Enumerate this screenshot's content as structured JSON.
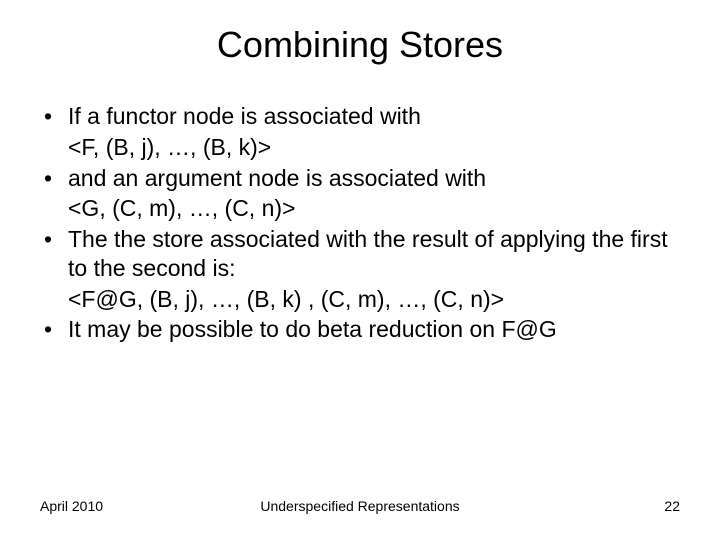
{
  "title": "Combining Stores",
  "bullets": [
    {
      "text": "If a functor node  is associated with",
      "sub": "<F, (B, j), …, (B, k)>"
    },
    {
      "text": "and an argument node is associated with",
      "sub": "<G, (C, m), …, (C, n)>"
    },
    {
      "text": "The the store associated with the result of applying the first to the second is:",
      "sub": "<F@G, (B, j), …, (B, k) , (C, m), …, (C, n)>"
    },
    {
      "text": "It may be possible to do beta reduction on F@G",
      "sub": ""
    }
  ],
  "footer": {
    "left": "April 2010",
    "center": "Underspecified Representations",
    "right": "22"
  }
}
